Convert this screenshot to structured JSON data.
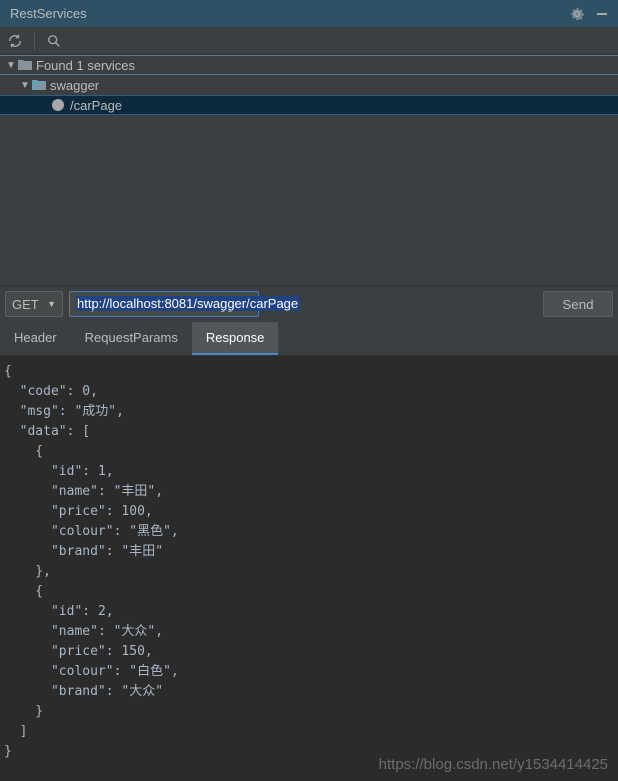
{
  "header": {
    "title": "RestServices"
  },
  "tree": {
    "root_label": "Found 1 services",
    "service_label": "swagger",
    "endpoint_label": "/carPage"
  },
  "request": {
    "method": "GET",
    "url": "http://localhost:8081/swagger/carPage",
    "send_label": "Send"
  },
  "tabs": {
    "header": "Header",
    "params": "RequestParams",
    "response": "Response"
  },
  "response": {
    "code_key": "\"code\"",
    "code_val": "0",
    "msg_key": "\"msg\"",
    "msg_val": "\"成功\"",
    "data_key": "\"data\"",
    "id_key": "\"id\"",
    "name_key": "\"name\"",
    "price_key": "\"price\"",
    "colour_key": "\"colour\"",
    "brand_key": "\"brand\"",
    "items": [
      {
        "id": "1",
        "name": "\"丰田\"",
        "price": "100",
        "colour": "\"黑色\"",
        "brand": "\"丰田\""
      },
      {
        "id": "2",
        "name": "\"大众\"",
        "price": "150",
        "colour": "\"白色\"",
        "brand": "\"大众\""
      }
    ]
  },
  "watermark": "https://blog.csdn.net/y1534414425"
}
